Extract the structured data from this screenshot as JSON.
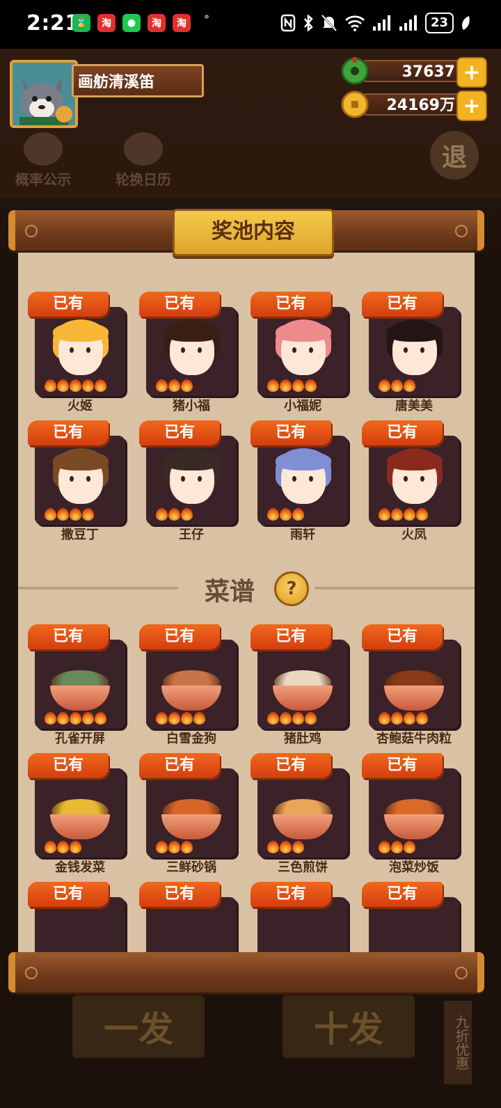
{
  "status_bar": {
    "time": "2:21",
    "battery": "23"
  },
  "player": {
    "name": "画舫清溪笛"
  },
  "currency": [
    {
      "name": "jade",
      "value": "37637"
    },
    {
      "name": "gold",
      "value": "24169万"
    }
  ],
  "background_buttons": {
    "probability": "概率公示",
    "calendar": "轮换日历",
    "exit": "退",
    "one_pull": "一发",
    "ten_pull": "十发",
    "discount": "九折优惠"
  },
  "panel": {
    "title": "奖池内容",
    "owned_badge": "已有"
  },
  "characters": [
    {
      "name": "火姬",
      "flames": 5,
      "hair": "#f7b636"
    },
    {
      "name": "猪小福",
      "flames": 3,
      "hair": "#3a1e14"
    },
    {
      "name": "小福妮",
      "flames": 4,
      "hair": "#ef8a8c"
    },
    {
      "name": "唐美美",
      "flames": 3,
      "hair": "#241414"
    },
    {
      "name": "撒豆丁",
      "flames": 4,
      "hair": "#7a4a24"
    },
    {
      "name": "王仔",
      "flames": 3,
      "hair": "#3a2a26"
    },
    {
      "name": "雨轩",
      "flames": 3,
      "hair": "#7f8fd4"
    },
    {
      "name": "火凤",
      "flames": 4,
      "hair": "#8a2a1e"
    }
  ],
  "recipes_section": {
    "title": "菜谱",
    "help": "?"
  },
  "recipes": [
    {
      "name": "孔雀开屏",
      "flames": 5,
      "color": "#6a8a5a"
    },
    {
      "name": "白雪金狗",
      "flames": 4,
      "color": "#c7744a"
    },
    {
      "name": "猪肚鸡",
      "flames": 4,
      "color": "#e9d9c3"
    },
    {
      "name": "杏鲍菇牛肉粒",
      "flames": 4,
      "color": "#8a3a1a"
    },
    {
      "name": "金钱发菜",
      "flames": 3,
      "color": "#e8b934"
    },
    {
      "name": "三鲜砂锅",
      "flames": 3,
      "color": "#d9652a"
    },
    {
      "name": "三色煎饼",
      "flames": 3,
      "color": "#e8a65a"
    },
    {
      "name": "泡菜炒饭",
      "flames": 3,
      "color": "#d96a2a"
    },
    {
      "name": "",
      "flames": 0,
      "color": "#3b2128"
    },
    {
      "name": "",
      "flames": 0,
      "color": "#3b2128"
    },
    {
      "name": "",
      "flames": 0,
      "color": "#3b2128"
    },
    {
      "name": "",
      "flames": 0,
      "color": "#3b2128"
    }
  ]
}
